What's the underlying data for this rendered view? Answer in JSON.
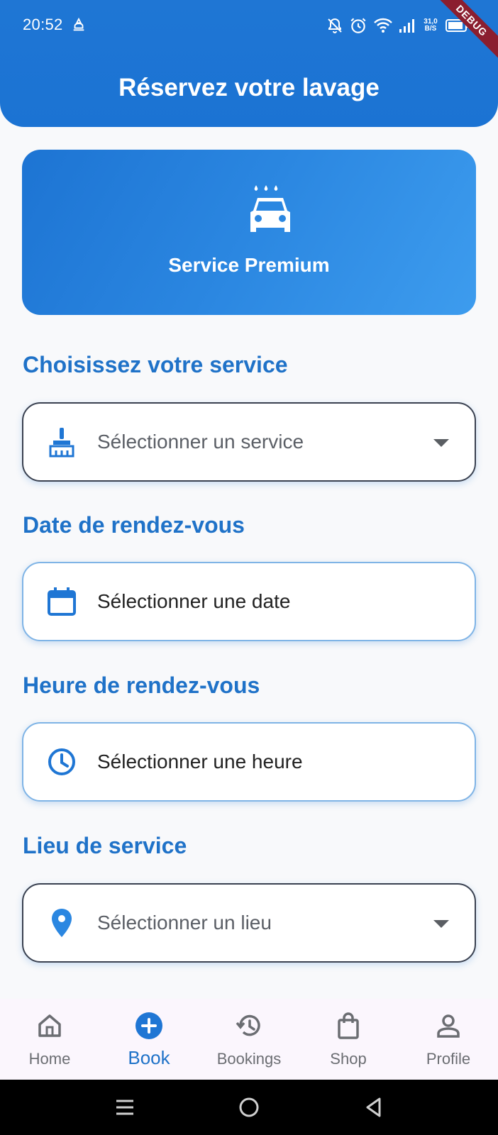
{
  "status_bar": {
    "time": "20:52",
    "netspeed_value": "31,0",
    "netspeed_unit": "B/S",
    "icons": [
      "dnd-bell-off-icon",
      "alarm-icon",
      "wifi-icon",
      "signal-icon",
      "battery-icon"
    ]
  },
  "debug_banner": "DEBUG",
  "header": {
    "title": "Réservez votre lavage"
  },
  "hero": {
    "icon": "car-wash-icon",
    "title": "Service Premium"
  },
  "form": {
    "service": {
      "label": "Choisissez votre service",
      "placeholder": "Sélectionner un service",
      "icon": "cleaning-brush-icon"
    },
    "date": {
      "label": "Date de rendez-vous",
      "placeholder": "Sélectionner une date",
      "icon": "calendar-icon"
    },
    "time": {
      "label": "Heure de rendez-vous",
      "placeholder": "Sélectionner une heure",
      "icon": "clock-icon"
    },
    "location": {
      "label": "Lieu de service",
      "placeholder": "Sélectionner un lieu",
      "icon": "location-pin-icon"
    }
  },
  "bottom_nav": {
    "active": "Book",
    "items": [
      {
        "label": "Home",
        "icon": "home-icon"
      },
      {
        "label": "Book",
        "icon": "add-circle-icon"
      },
      {
        "label": "Bookings",
        "icon": "history-icon"
      },
      {
        "label": "Shop",
        "icon": "shopping-bag-icon"
      },
      {
        "label": "Profile",
        "icon": "person-icon"
      }
    ]
  },
  "colors": {
    "primary": "#1f76d4",
    "label_blue": "#1f72c8",
    "background": "#f8f9fb",
    "nav_background": "#fbf6fd"
  }
}
